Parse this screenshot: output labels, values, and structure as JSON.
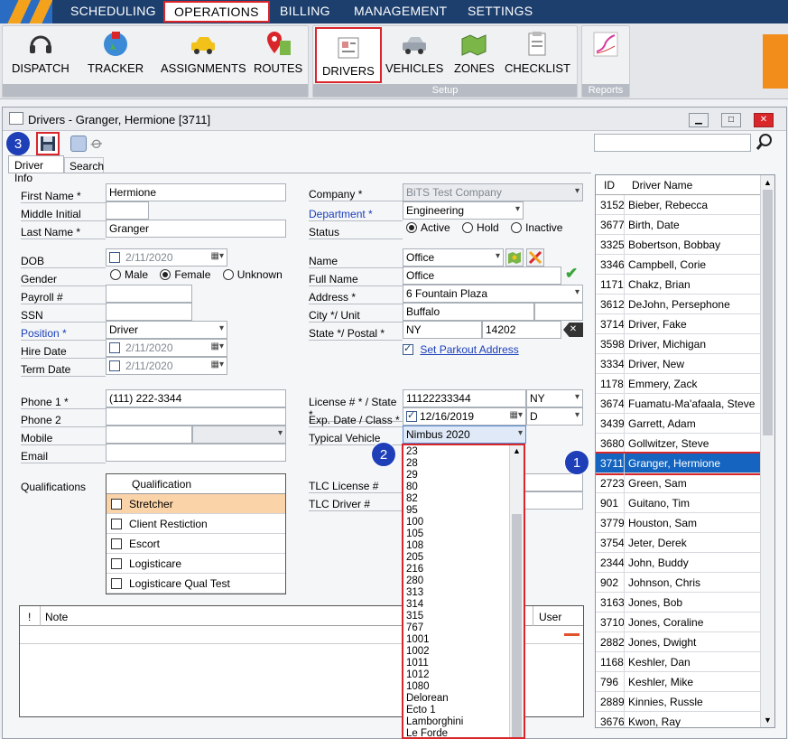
{
  "menu": {
    "items": [
      "SCHEDULING",
      "OPERATIONS",
      "BILLING",
      "MANAGEMENT",
      "SETTINGS"
    ],
    "selected": "OPERATIONS"
  },
  "ribbon": {
    "buttons": [
      "DISPATCH",
      "TRACKER",
      "ASSIGNMENTS",
      "ROUTES",
      "DRIVERS",
      "VEHICLES",
      "ZONES",
      "CHECKLIST"
    ],
    "group_setup": "Setup",
    "group_reports": "Reports"
  },
  "window": {
    "title": "Drivers - Granger, Hermione [3711]",
    "tab_info": "Driver Info",
    "tab_search": "Search",
    "search_value": ""
  },
  "badges": {
    "b1": "1",
    "b2": "2",
    "b3": "3"
  },
  "form": {
    "first_name_label": "First Name *",
    "first_name": "Hermione",
    "middle_initial_label": "Middle Initial",
    "middle_initial": "",
    "last_name_label": "Last Name *",
    "last_name": "Granger",
    "dob_label": "DOB",
    "dob": "2/11/2020",
    "gender_label": "Gender",
    "gender_male": "Male",
    "gender_female": "Female",
    "gender_unknown": "Unknown",
    "payroll_label": "Payroll #",
    "ssn_label": "SSN",
    "position_label": "Position *",
    "position": "Driver",
    "hire_date_label": "Hire Date",
    "hire_date": "2/11/2020",
    "term_date_label": "Term Date",
    "term_date": "2/11/2020",
    "phone1_label": "Phone 1 *",
    "phone1": "(111) 222-3344",
    "phone2_label": "Phone 2",
    "mobile_label": "Mobile",
    "email_label": "Email",
    "qualifications_label": "Qualifications",
    "company_label": "Company *",
    "company": "BiTS Test Company",
    "department_label": "Department *",
    "department": "Engineering",
    "status_label": "Status",
    "status_active": "Active",
    "status_hold": "Hold",
    "status_inactive": "Inactive",
    "name_label": "Name",
    "name_select": "Office",
    "full_name_label": "Full Name",
    "full_name": "Office",
    "address_label": "Address *",
    "address": "6 Fountain Plaza",
    "city_label": "City */ Unit",
    "city": "Buffalo",
    "state_label": "State */ Postal *",
    "state": "NY",
    "postal": "14202",
    "parkout_link": "Set Parkout Address",
    "license_label": "License # * / State *",
    "license": "11122233344",
    "license_state": "NY",
    "exp_label": "Exp. Date / Class *",
    "exp_date": "12/16/2019",
    "license_class": "D",
    "typical_vehicle_label": "Typical Vehicle",
    "typical_vehicle": "Nimbus 2020",
    "tlc_license_label": "TLC License #",
    "tlc_driver_label": "TLC Driver #"
  },
  "qualifications": {
    "header": "Qualification",
    "rows": [
      "Stretcher",
      "Client Restiction",
      "Escort",
      "Logisticare",
      "Logisticare Qual Test"
    ]
  },
  "notes": {
    "col_bang": "!",
    "col_note": "Note",
    "col_user": "User"
  },
  "vehicle_dropdown": [
    "23",
    "28",
    "29",
    "80",
    "82",
    "95",
    "100",
    "105",
    "108",
    "205",
    "216",
    "280",
    "313",
    "314",
    "315",
    "767",
    "1001",
    "1002",
    "1011",
    "1012",
    "1080",
    "Delorean",
    "Ecto 1",
    "Lamborghini",
    "Le Forde"
  ],
  "driver_list": {
    "col_id": "ID",
    "col_name": "Driver Name",
    "rows": [
      [
        "3152",
        "Bieber, Rebecca"
      ],
      [
        "3677",
        "Birth, Date"
      ],
      [
        "3325",
        "Bobertson, Bobbay"
      ],
      [
        "3346",
        "Campbell, Corie"
      ],
      [
        "1171",
        "Chakz, Brian"
      ],
      [
        "3612",
        "DeJohn, Persephone"
      ],
      [
        "3714",
        "Driver, Fake"
      ],
      [
        "3598",
        "Driver, Michigan"
      ],
      [
        "3334",
        "Driver, New"
      ],
      [
        "1178",
        "Emmery, Zack"
      ],
      [
        "3674",
        "Fuamatu-Ma'afaala, Steve"
      ],
      [
        "3439",
        "Garrett, Adam"
      ],
      [
        "3680",
        "Gollwitzer, Steve"
      ],
      [
        "3711",
        "Granger, Hermione"
      ],
      [
        "2723",
        "Green, Sam"
      ],
      [
        "901",
        "Guitano, Tim"
      ],
      [
        "3779",
        "Houston, Sam"
      ],
      [
        "3754",
        "Jeter, Derek"
      ],
      [
        "2344",
        "John, Buddy"
      ],
      [
        "902",
        "Johnson, Chris"
      ],
      [
        "3163",
        "Jones, Bob"
      ],
      [
        "3710",
        "Jones, Coraline"
      ],
      [
        "2882",
        "Jones, Dwight"
      ],
      [
        "1168",
        "Keshler, Dan"
      ],
      [
        "796",
        "Keshler, Mike"
      ],
      [
        "2889",
        "Kinnies, Russle"
      ],
      [
        "3676",
        "Kwon, Ray"
      ]
    ],
    "selected": "3711"
  }
}
